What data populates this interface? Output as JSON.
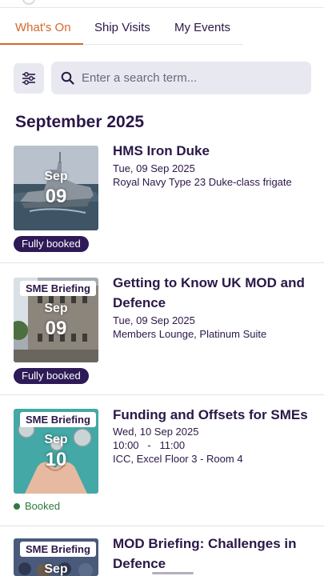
{
  "tabs": [
    {
      "label": "What's On",
      "active": true
    },
    {
      "label": "Ship Visits",
      "active": false
    },
    {
      "label": "My Events",
      "active": false
    }
  ],
  "search": {
    "placeholder": "Enter a search term...",
    "value": ""
  },
  "section": {
    "month_heading": "September 2025"
  },
  "events": [
    {
      "title": "HMS Iron Duke",
      "date": "Tue, 09 Sep 2025",
      "location": "Royal Navy Type 23 Duke-class frigate",
      "thumb_month": "Sep",
      "thumb_day": "09",
      "status": "Fully booked",
      "image": "frigate-at-sea"
    },
    {
      "title": "Getting to Know UK MOD and Defence",
      "tag": "SME Briefing",
      "date": "Tue, 09 Sep 2025",
      "location": "Members Lounge, Platinum Suite",
      "thumb_month": "Sep",
      "thumb_day": "09",
      "status": "Fully booked",
      "image": "government-building"
    },
    {
      "title": "Funding and Offsets for SMEs",
      "tag": "SME Briefing",
      "date": "Wed, 10 Sep 2025",
      "time": "10:00   -   11:00",
      "location": "ICC, Excel Floor 3 - Room 4",
      "thumb_month": "Sep",
      "thumb_day": "10",
      "status": "Booked",
      "image": "hands-with-coins"
    },
    {
      "title": "MOD Briefing: Challenges in Defence",
      "tag": "SME Briefing",
      "thumb_month": "Sep",
      "image": "crowd"
    }
  ],
  "colors": {
    "accent": "#d16a2a",
    "primary_text": "#2a1848",
    "pill_bg": "#2e1a57",
    "booked_green": "#2e7a3e",
    "search_bg": "#e8e9f0"
  }
}
